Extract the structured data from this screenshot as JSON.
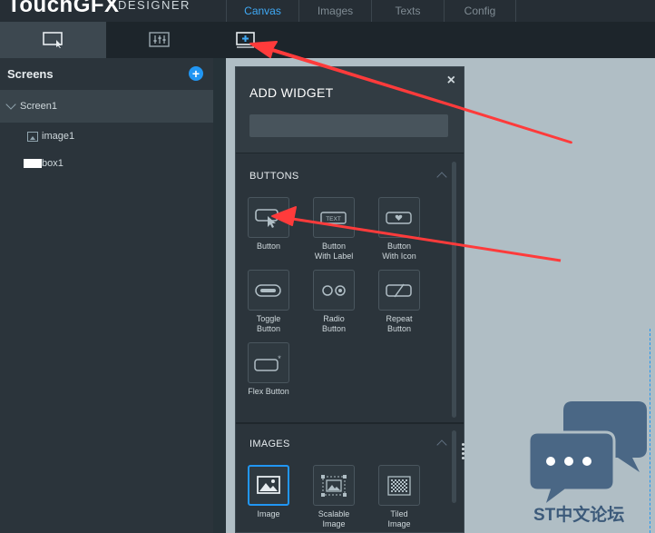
{
  "app": {
    "logo_main": "TouchGFX",
    "logo_sub": "DESIGNER"
  },
  "tabs": [
    {
      "label": "Canvas",
      "active": true
    },
    {
      "label": "Images",
      "active": false
    },
    {
      "label": "Texts",
      "active": false
    },
    {
      "label": "Config",
      "active": false
    }
  ],
  "toolbar": {
    "canvas_icon": "canvas-select-icon",
    "properties_icon": "properties-icon",
    "add_icon": "add-widget-icon"
  },
  "screens": {
    "title": "Screens",
    "add_label": "+",
    "items": [
      {
        "label": "Screen1",
        "type": "screen"
      },
      {
        "label": "image1",
        "type": "image"
      },
      {
        "label": "box1",
        "type": "box"
      }
    ]
  },
  "panel": {
    "title": "ADD WIDGET",
    "close": "×",
    "search_placeholder": "",
    "sections": [
      {
        "title": "BUTTONS",
        "items": [
          {
            "label": "Button",
            "icon": "button-icon"
          },
          {
            "label": "Button\nWith Label",
            "icon": "button-with-label-icon",
            "tile_text": "TEXT"
          },
          {
            "label": "Button\nWith Icon",
            "icon": "button-with-icon-icon"
          },
          {
            "label": "Toggle\nButton",
            "icon": "toggle-button-icon"
          },
          {
            "label": "Radio\nButton",
            "icon": "radio-button-icon"
          },
          {
            "label": "Repeat\nButton",
            "icon": "repeat-button-icon"
          },
          {
            "label": "Flex Button",
            "icon": "flex-button-icon"
          }
        ]
      },
      {
        "title": "IMAGES",
        "items": [
          {
            "label": "Image",
            "icon": "image-icon",
            "selected": true
          },
          {
            "label": "Scalable\nImage",
            "icon": "scalable-image-icon"
          },
          {
            "label": "Tiled\nImage",
            "icon": "tiled-image-icon"
          }
        ]
      }
    ]
  },
  "watermark": {
    "text": "ST中文论坛"
  },
  "colors": {
    "accent": "#2196f3",
    "arrow": "#ff3b3b",
    "canvas": "#b0bec5"
  }
}
